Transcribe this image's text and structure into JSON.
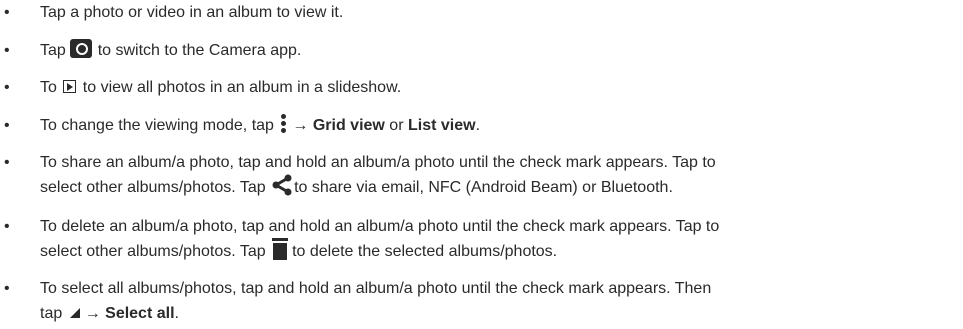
{
  "bullet": "•",
  "items": [
    {
      "text": "Tap a photo or video in an album to view it."
    },
    {
      "pre": "Tap ",
      "post": " to switch to the Camera app.",
      "icon": "camera-icon"
    },
    {
      "pre": "To ",
      "post": " to view all photos in an album in a slideshow.",
      "icon": "slideshow-play-icon"
    },
    {
      "pre": "To change the viewing mode, tap ",
      "arrow": "→",
      "b1": "Grid view",
      "or": " or ",
      "b2": "List view",
      "end": ".",
      "icon": "more-options-icon"
    },
    {
      "line1": "To share an album/a photo, tap and hold an album/a photo until the check mark appears. Tap to",
      "pre2": "select other albums/photos. Tap ",
      "post2": "to share via email, NFC (Android Beam) or Bluetooth.",
      "icon": "share-icon"
    },
    {
      "line1": "To delete an album/a photo, tap and hold an album/a photo until the check mark appears. Tap to",
      "pre2": "select other albums/photos. Tap ",
      "post2": "to delete the selected albums/photos.",
      "icon": "trash-icon"
    },
    {
      "line1": "To select all albums/photos, tap and hold an album/a photo until the check mark appears. Then",
      "pre2": "tap ",
      "arrow": "→",
      "b": "Select all",
      "end": ".",
      "icon": "corner-triangle-icon"
    }
  ]
}
